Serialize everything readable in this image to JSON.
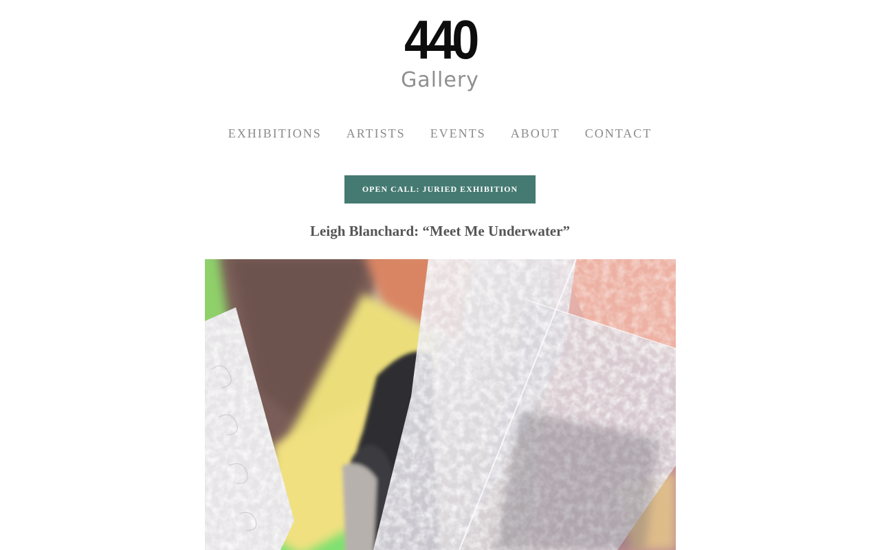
{
  "logo": {
    "number": "440",
    "word": "Gallery"
  },
  "nav": {
    "items": [
      {
        "label": "EXHIBITIONS"
      },
      {
        "label": "ARTISTS"
      },
      {
        "label": "EVENTS"
      },
      {
        "label": "ABOUT"
      },
      {
        "label": "CONTACT"
      }
    ]
  },
  "cta": {
    "label": "OPEN CALL: JURIED EXHIBITION"
  },
  "feature": {
    "title": "Leigh Blanchard: “Meet Me Underwater”"
  },
  "colors": {
    "accent": "#447a72",
    "nav_text": "#8a8a8a",
    "title_text": "#555555",
    "logo_number": "#0d0d0d",
    "logo_word": "#8f8f8f"
  }
}
